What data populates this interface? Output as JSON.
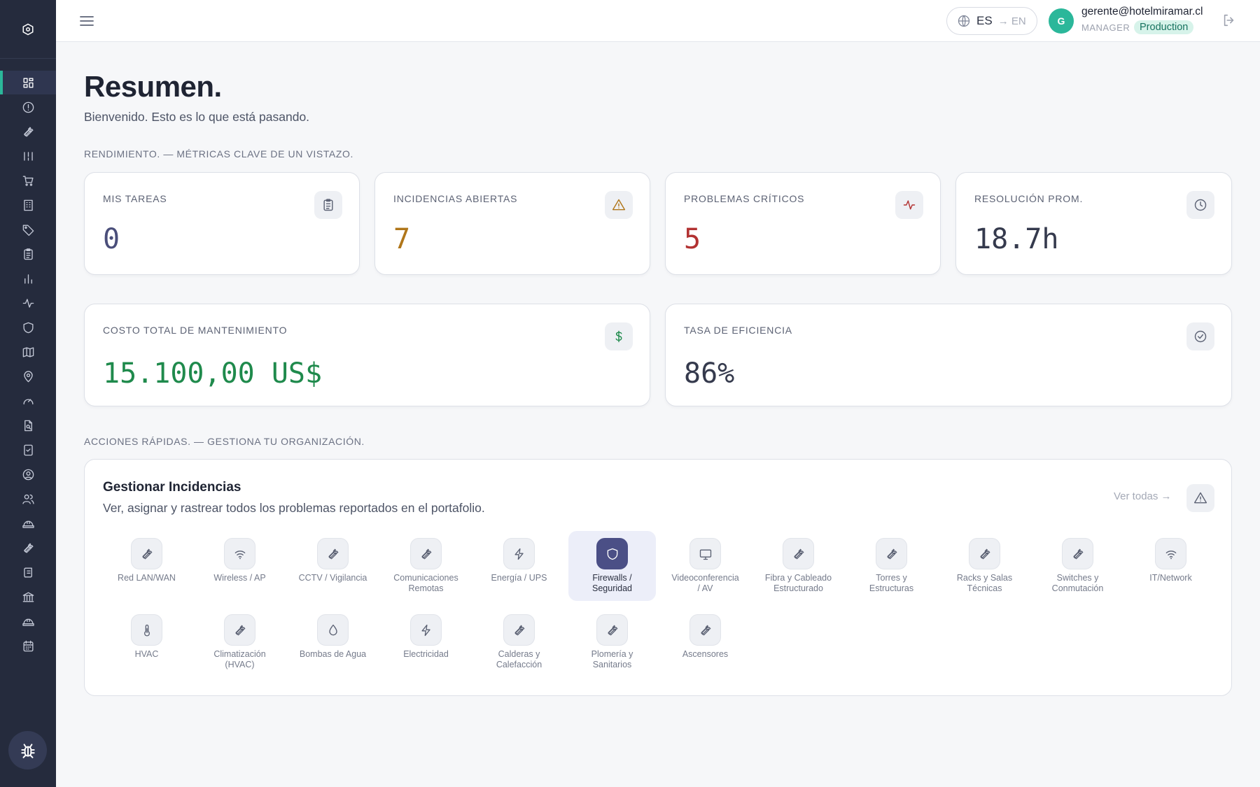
{
  "user": {
    "email": "gerente@hotelmiramar.cl",
    "role": "MANAGER",
    "environment": "Production",
    "avatar_initial": "G"
  },
  "language": {
    "current": "ES",
    "switch_to": "→ EN"
  },
  "page": {
    "title": "Resumen.",
    "subtitle": "Bienvenido. Esto es lo que está pasando."
  },
  "sections": {
    "performance": "RENDIMIENTO. — MÉTRICAS CLAVE DE UN VISTAZO.",
    "quick_actions": "ACCIONES RÁPIDAS. — GESTIONA TU ORGANIZACIÓN."
  },
  "metrics": [
    {
      "label": "MIS TAREAS",
      "value": "0",
      "color": "#4a4e7a",
      "icon": "clipboard-icon"
    },
    {
      "label": "INCIDENCIAS ABIERTAS",
      "value": "7",
      "color": "#b0761a",
      "icon": "warning-icon"
    },
    {
      "label": "PROBLEMAS CRÍTICOS",
      "value": "5",
      "color": "#b23232",
      "icon": "activity-icon"
    },
    {
      "label": "RESOLUCIÓN PROM.",
      "value": "18.7h",
      "color": "#353a4d",
      "icon": "clock-icon"
    },
    {
      "label": "COSTO TOTAL DE MANTENIMIENTO",
      "value": "15.100,00 US$",
      "color": "#1f8a4c",
      "icon": "dollar-icon"
    },
    {
      "label": "TASA DE EFICIENCIA",
      "value": "86%",
      "color": "#353a4d",
      "icon": "check-circle-icon"
    }
  ],
  "actions": {
    "title": "Gestionar Incidencias",
    "description": "Ver, asignar y rastrear todos los problemas reportados en el portafolio.",
    "view_all": "Ver todas →",
    "categories": [
      {
        "label_1": "Red LAN/WAN",
        "label_2": "",
        "icon": "wrench-icon"
      },
      {
        "label_1": "Wireless / AP",
        "label_2": "",
        "icon": "wifi-icon"
      },
      {
        "label_1": "CCTV / Vigilancia",
        "label_2": "",
        "icon": "wrench-icon"
      },
      {
        "label_1": "Comunicaciones",
        "label_2": "Remotas",
        "icon": "wrench-icon"
      },
      {
        "label_1": "Energía / UPS",
        "label_2": "",
        "icon": "bolt-icon"
      },
      {
        "label_1": "Firewalls /",
        "label_2": "Seguridad",
        "icon": "shield-icon",
        "selected": true
      },
      {
        "label_1": "Videoconferencia",
        "label_2": "/ AV",
        "icon": "monitor-icon"
      },
      {
        "label_1": "Fibra y Cableado",
        "label_2": "Estructurado",
        "icon": "wrench-icon"
      },
      {
        "label_1": "Torres y",
        "label_2": "Estructuras",
        "icon": "wrench-icon"
      },
      {
        "label_1": "Racks y Salas",
        "label_2": "Técnicas",
        "icon": "wrench-icon"
      },
      {
        "label_1": "Switches y",
        "label_2": "Conmutación",
        "icon": "wrench-icon"
      },
      {
        "label_1": "IT/Network",
        "label_2": "",
        "icon": "wifi-icon"
      },
      {
        "label_1": "HVAC",
        "label_2": "",
        "icon": "thermometer-icon"
      },
      {
        "label_1": "Climatización",
        "label_2": "(HVAC)",
        "icon": "wrench-icon"
      },
      {
        "label_1": "Bombas de Agua",
        "label_2": "",
        "icon": "droplet-icon"
      },
      {
        "label_1": "Electricidad",
        "label_2": "",
        "icon": "bolt-icon"
      },
      {
        "label_1": "Calderas y",
        "label_2": "Calefacción",
        "icon": "wrench-icon"
      },
      {
        "label_1": "Plomería y",
        "label_2": "Sanitarios",
        "icon": "wrench-icon"
      },
      {
        "label_1": "Ascensores",
        "label_2": "",
        "icon": "wrench-icon"
      }
    ]
  },
  "sidebar": {
    "items": [
      "dashboard-icon",
      "alert-circle-icon",
      "wrench-icon",
      "columns-icon",
      "cart-icon",
      "building-icon",
      "tag-icon",
      "clipboard-icon",
      "bar-chart-icon",
      "activity-icon",
      "shield-icon",
      "map-icon",
      "map-pin-icon",
      "gauge-icon",
      "file-search-icon",
      "checklist-icon",
      "user-circle-icon",
      "users-icon",
      "helmet-icon",
      "wrench-icon",
      "scroll-icon",
      "bank-icon",
      "helmet-icon",
      "calendar-icon"
    ]
  }
}
